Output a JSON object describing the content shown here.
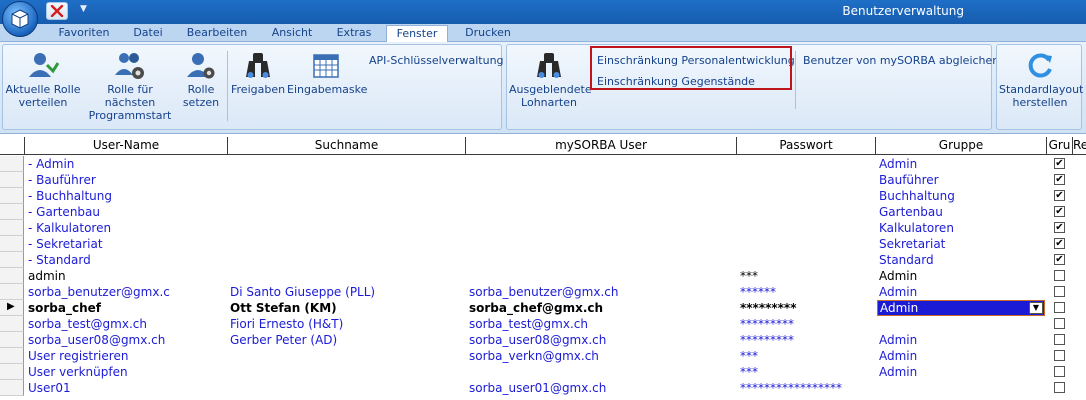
{
  "window": {
    "title": "Benutzerverwaltung"
  },
  "tabs": [
    {
      "label": "Favoriten"
    },
    {
      "label": "Datei"
    },
    {
      "label": "Bearbeiten"
    },
    {
      "label": "Ansicht"
    },
    {
      "label": "Extras"
    },
    {
      "label": "Fenster",
      "active": true
    },
    {
      "label": "Drucken"
    }
  ],
  "ribbon": {
    "aktuelle_rolle": "Aktuelle Rolle verteilen",
    "rolle_naechster_start": "Rolle für nächsten Programmstart",
    "rolle_setzen": "Rolle setzen",
    "freigaben": "Freigaben",
    "eingabemaske": "Eingabemaske",
    "api_key": "API-Schlüsselverwaltung",
    "ausgeblendete_lohnarten": "Ausgeblendete Lohnarten",
    "einschraenkung_personal": "Einschränkung Personalentwicklung",
    "einschraenkung_gegenstaende": "Einschränkung Gegenstände",
    "benutzer_abgleichen": "Benutzer von mySORBA abgleichen",
    "standardlayout": "Standardlayout herstellen"
  },
  "columns": [
    "User-Name",
    "Suchname",
    "mySORBA User",
    "Passwort",
    "Gruppe",
    "Gru",
    "Re"
  ],
  "rows": [
    {
      "user": "- Admin",
      "such": "",
      "my": "",
      "pw": "",
      "grp": "Admin",
      "chk": true,
      "style": "blue"
    },
    {
      "user": "- Bauführer",
      "such": "",
      "my": "",
      "pw": "",
      "grp": "Bauführer",
      "chk": true,
      "style": "blue"
    },
    {
      "user": "- Buchhaltung",
      "such": "",
      "my": "",
      "pw": "",
      "grp": "Buchhaltung",
      "chk": true,
      "style": "blue"
    },
    {
      "user": "- Gartenbau",
      "such": "",
      "my": "",
      "pw": "",
      "grp": "Gartenbau",
      "chk": true,
      "style": "blue"
    },
    {
      "user": "- Kalkulatoren",
      "such": "",
      "my": "",
      "pw": "",
      "grp": "Kalkulatoren",
      "chk": true,
      "style": "blue"
    },
    {
      "user": "- Sekretariat",
      "such": "",
      "my": "",
      "pw": "",
      "grp": "Sekretariat",
      "chk": true,
      "style": "blue"
    },
    {
      "user": "- Standard",
      "such": "",
      "my": "",
      "pw": "",
      "grp": "Standard",
      "chk": true,
      "style": "blue"
    },
    {
      "user": "admin",
      "such": "",
      "my": "",
      "pw": "***",
      "grp": "Admin",
      "chk": false,
      "style": "black"
    },
    {
      "user": "sorba_benutzer@gmx.c",
      "such": "Di Santo Giuseppe (PLL)",
      "my": "sorba_benutzer@gmx.ch",
      "pw": "******",
      "grp": "Admin",
      "chk": false,
      "style": "blue"
    },
    {
      "user": "sorba_chef",
      "such": "Ott Stefan (KM)",
      "my": "sorba_chef@gmx.ch",
      "pw": "*********",
      "grp": "Admin",
      "chk": false,
      "style": "current"
    },
    {
      "user": "sorba_test@gmx.ch",
      "such": "Fiori Ernesto (H&T)",
      "my": "sorba_test@gmx.ch",
      "pw": "*********",
      "grp": "",
      "chk": false,
      "style": "blue"
    },
    {
      "user": "sorba_user08@gmx.ch",
      "such": "Gerber Peter (AD)",
      "my": "sorba_user08@gmx.ch",
      "pw": "*********",
      "grp": "Admin",
      "chk": false,
      "style": "blue"
    },
    {
      "user": "User registrieren",
      "such": "",
      "my": "sorba_verkn@gmx.ch",
      "pw": "***",
      "grp": "Admin",
      "chk": false,
      "style": "blue"
    },
    {
      "user": "User verknüpfen",
      "such": "",
      "my": "",
      "pw": "***",
      "grp": "Admin",
      "chk": false,
      "style": "blue"
    },
    {
      "user": "User01",
      "such": "",
      "my": "sorba_user01@gmx.ch",
      "pw": "*****************",
      "grp": "",
      "chk": false,
      "style": "blue"
    }
  ]
}
